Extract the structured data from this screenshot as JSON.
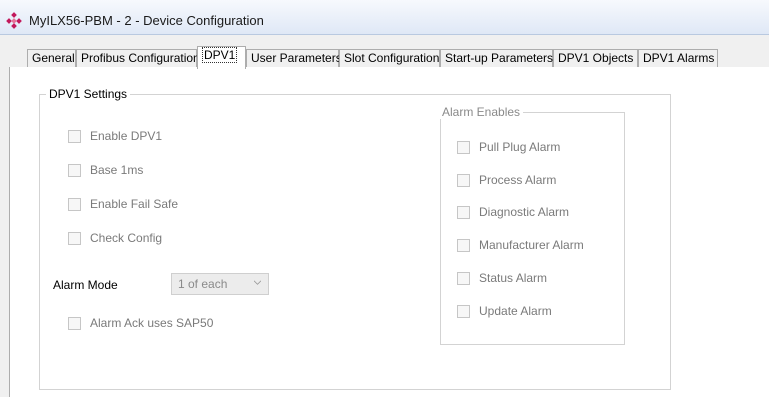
{
  "window": {
    "title": "MyILX56-PBM - 2 - Device Configuration",
    "icon": "prosoft-diamond-icon",
    "icon_color": "#c2185b"
  },
  "tabs": [
    {
      "label": "General"
    },
    {
      "label": "Profibus Configuration"
    },
    {
      "label": "DPV1",
      "active": true
    },
    {
      "label": "User Parameters"
    },
    {
      "label": "Slot Configuration"
    },
    {
      "label": "Start-up Parameters"
    },
    {
      "label": "DPV1 Objects"
    },
    {
      "label": "DPV1 Alarms"
    }
  ],
  "dpv1_settings": {
    "legend": "DPV1 Settings",
    "checkboxes": [
      {
        "label": "Enable DPV1",
        "checked": false,
        "enabled": false
      },
      {
        "label": "Base 1ms",
        "checked": false,
        "enabled": false
      },
      {
        "label": "Enable Fail Safe",
        "checked": false,
        "enabled": false
      },
      {
        "label": "Check Config",
        "checked": false,
        "enabled": false
      }
    ],
    "alarm_mode": {
      "label": "Alarm Mode",
      "value": "1 of each",
      "enabled": false
    },
    "alarm_ack": {
      "label": "Alarm Ack uses SAP50",
      "checked": false,
      "enabled": false
    }
  },
  "alarm_enables": {
    "legend": "Alarm Enables",
    "checkboxes": [
      {
        "label": "Pull Plug Alarm",
        "checked": false,
        "enabled": false
      },
      {
        "label": "Process Alarm",
        "checked": false,
        "enabled": false
      },
      {
        "label": "Diagnostic Alarm",
        "checked": false,
        "enabled": false
      },
      {
        "label": "Manufacturer Alarm",
        "checked": false,
        "enabled": false
      },
      {
        "label": "Status Alarm",
        "checked": false,
        "enabled": false
      },
      {
        "label": "Update Alarm",
        "checked": false,
        "enabled": false
      }
    ]
  }
}
